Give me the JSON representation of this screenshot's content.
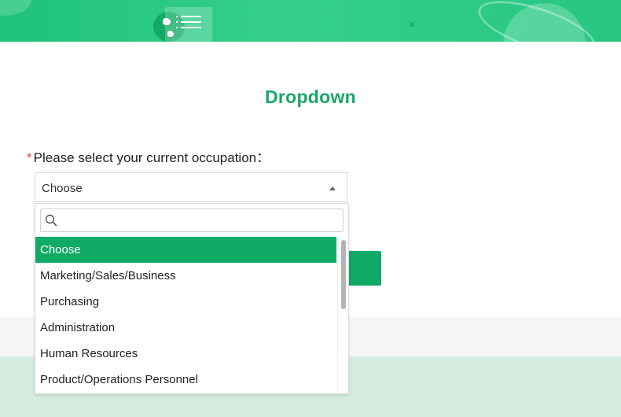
{
  "header": {
    "menu_icon": "menu-list-icon",
    "logo_icon": "globe-icon"
  },
  "page": {
    "title": "Dropdown"
  },
  "form": {
    "required_mark": "*",
    "question": "Please select your current occupation：",
    "select_value": "Choose",
    "search_placeholder": "",
    "options": [
      "Choose",
      "Marketing/Sales/Business",
      "Purchasing",
      "Administration",
      "Human Resources",
      "Product/Operations Personnel"
    ],
    "selected_index": 0
  },
  "colors": {
    "accent": "#10aa67",
    "title": "#18a866",
    "required": "#e5484d"
  }
}
